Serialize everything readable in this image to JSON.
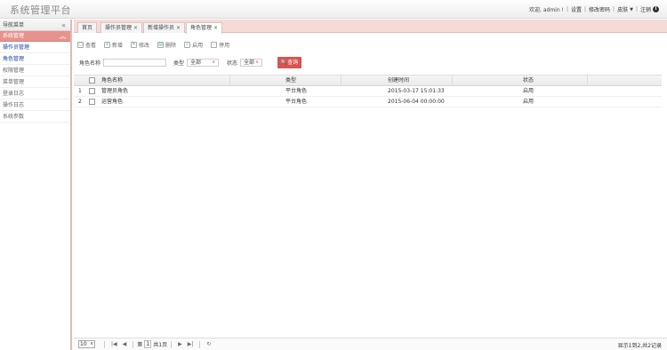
{
  "header": {
    "app_title": "系统管理平台",
    "greeting": "欢迎, admin !",
    "links": [
      "设置",
      "修改密码",
      "皮肤"
    ],
    "logout": "注销"
  },
  "sidebar": {
    "title": "导航菜单",
    "collapse_icon": "double-chevron-left-icon",
    "group": "系统管理",
    "group_icon": "double-chevron-up-icon",
    "items": [
      {
        "label": "操作员管理",
        "color": "#1b3fa5"
      },
      {
        "label": "角色管理",
        "color": "#1b3fa5"
      },
      {
        "label": "权限管理",
        "color": "#666666"
      },
      {
        "label": "菜单管理",
        "color": "#666666"
      },
      {
        "label": "登录日志",
        "color": "#666666"
      },
      {
        "label": "操作日志",
        "color": "#666666"
      },
      {
        "label": "系统参数",
        "color": "#666666"
      }
    ]
  },
  "tabs": [
    {
      "label": "首页",
      "closable": false
    },
    {
      "label": "操作员管理",
      "closable": true
    },
    {
      "label": "新增操作员",
      "closable": true
    },
    {
      "label": "角色管理",
      "closable": true,
      "active": true
    }
  ],
  "toolbar": [
    "查看",
    "新增",
    "修改",
    "删除",
    "启用",
    "停用"
  ],
  "search": {
    "name_label": "角色名称",
    "name_value": "",
    "type_label": "类型",
    "type_value": "全部",
    "status_label": "状态",
    "status_value": "全部",
    "query_button": "查询"
  },
  "grid": {
    "columns": [
      "角色名称",
      "类型",
      "创建时间",
      "状态"
    ],
    "rows": [
      {
        "num": "1",
        "name": "管理员角色",
        "type": "平台角色",
        "time": "2015-03-17 15:01:33",
        "status": "启用"
      },
      {
        "num": "2",
        "name": "运营角色",
        "type": "平台角色",
        "time": "2015-06-04 00:00:00",
        "status": "启用"
      }
    ]
  },
  "pager": {
    "page_size": "10",
    "page_prefix": "第",
    "page_value": "1",
    "page_total": "共1页",
    "info": "显示1到2,共2记录"
  },
  "colors": {
    "accent": "#d9534f",
    "sidebar_group": "#e8928e",
    "tabbar": "#f6dad6",
    "link_blue": "#1b3fa5"
  }
}
